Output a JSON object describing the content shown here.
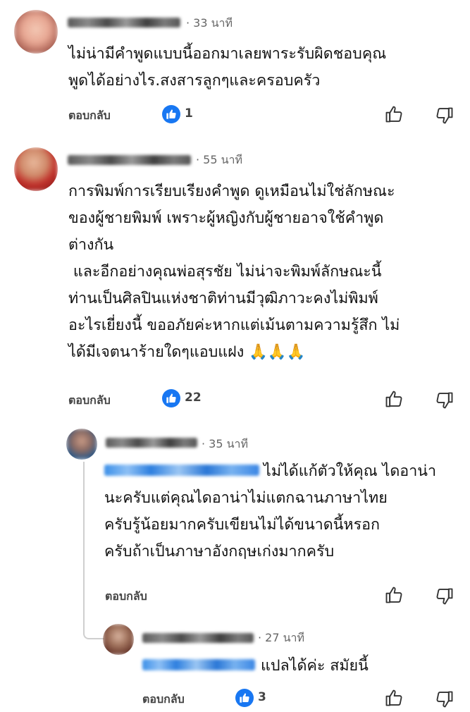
{
  "comments": [
    {
      "time": "· 33 นาที",
      "lines": [
        "ไม่น่ามีคำพูดแบบนี้ออกมาเลยพาระรับผิดชอบคุณ",
        "พูดได้อย่างไร.สงสารลูกๆและครอบครัว"
      ],
      "reply_label": "ตอบกลับ",
      "likes": "1"
    },
    {
      "time": "· 55 นาที",
      "lines": [
        "การพิมพ์การเรียบเรียงคำพูด ดูเหมือนไม่ใช่ลักษณะ",
        "ของผู้ชายพิมพ์ เพราะผู้หญิงกับผู้ชายอาจใช้คำพูด",
        "ต่างกัน",
        " และอีกอย่างคุณพ่อสุรชัย ไม่น่าจะพิมพ์ลักษณะนี้",
        "ท่านเป็นศิลปินแห่งชาติท่านมีวุฒิภาวะคงไม่พิมพ์",
        "อะไรเยี่ยงนี้ ขออภัยค่ะหากแต่เม้นตามความรู้สึก ไม่",
        "ได้มีเจตนาร้ายใดๆแอบแฝง 🙏🙏🙏"
      ],
      "reply_label": "ตอบกลับ",
      "likes": "22"
    },
    {
      "time": "· 35 นาที",
      "lines": [
        "ไม่ได้แก้ตัวให้คุณ ไดอาน่า",
        "นะครับแต่คุณไดอาน่าไม่แตกฉานภาษาไทย",
        "ครับรู้น้อยมากครับเขียนไม่ได้ขนาดนี้หรอก",
        "ครับถ้าเป็นภาษาอังกฤษเก่งมากครับ"
      ],
      "reply_label": "ตอบกลับ"
    },
    {
      "time": "· 27 นาที",
      "lines": [
        "แปลได้ค่ะ สมัยนี้"
      ],
      "reply_label": "ตอบกลับ",
      "likes": "3"
    }
  ],
  "colors": {
    "like_blue": "#1877f2",
    "text": "#111111",
    "meta": "#666666"
  },
  "icons": {
    "like": "thumbs-up-icon",
    "dislike": "thumbs-down-icon",
    "like_badge": "like-badge-icon"
  }
}
